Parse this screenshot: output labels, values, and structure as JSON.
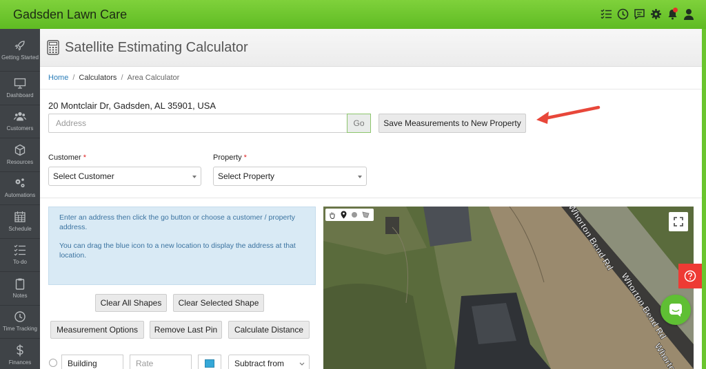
{
  "app": {
    "brand": "Gadsden Lawn Care"
  },
  "topbar": {
    "icons": [
      "tasks-icon",
      "clock-icon",
      "chat-icon",
      "gear-icon",
      "bell-icon",
      "user-icon"
    ]
  },
  "sidebar": {
    "items": [
      {
        "label": "Getting Started",
        "icon": "rocket-icon"
      },
      {
        "label": "Dashboard",
        "icon": "monitor-icon"
      },
      {
        "label": "Customers",
        "icon": "users-icon"
      },
      {
        "label": "Resources",
        "icon": "cube-icon"
      },
      {
        "label": "Automations",
        "icon": "gears-icon"
      },
      {
        "label": "Schedule",
        "icon": "calendar-icon"
      },
      {
        "label": "To-do",
        "icon": "list-icon"
      },
      {
        "label": "Notes",
        "icon": "clipboard-icon"
      },
      {
        "label": "Time Tracking",
        "icon": "clock-icon"
      },
      {
        "label": "Finances",
        "icon": "dollar-icon"
      }
    ]
  },
  "header": {
    "title": "Satellite Estimating Calculator"
  },
  "breadcrumb": {
    "home": "Home",
    "calculators": "Calculators",
    "current": "Area Calculator",
    "sep": "/"
  },
  "address": {
    "current": "20 Montclair Dr, Gadsden, AL 35901, USA",
    "placeholder": "Address",
    "go_label": "Go",
    "save_label": "Save Measurements to New Property"
  },
  "customer": {
    "label": "Customer",
    "required": "*",
    "value": "Select Customer"
  },
  "property": {
    "label": "Property",
    "required": "*",
    "value": "Select Property"
  },
  "info": {
    "line1": "Enter an address then click the go button or choose a customer / property address.",
    "line2": "You can drag the blue icon to a new location to display the address at that location."
  },
  "buttons": {
    "clear_all": "Clear All Shapes",
    "clear_selected": "Clear Selected Shape",
    "measurement_options": "Measurement Options",
    "remove_last_pin": "Remove Last Pin",
    "calculate_distance": "Calculate Distance"
  },
  "shape_row": {
    "name": "Building",
    "rate_placeholder": "Rate",
    "mode": "Subtract from",
    "color": "#35a8d8"
  },
  "map": {
    "road_label_1": "Whorton Bend Rd",
    "road_label_2": "Whorton Bend Rd",
    "road_label_3": "Whorton"
  },
  "colors": {
    "accent": "#6ac52e",
    "sidebar": "#3f4347",
    "link": "#2a7db8",
    "help": "#ee3b34"
  }
}
